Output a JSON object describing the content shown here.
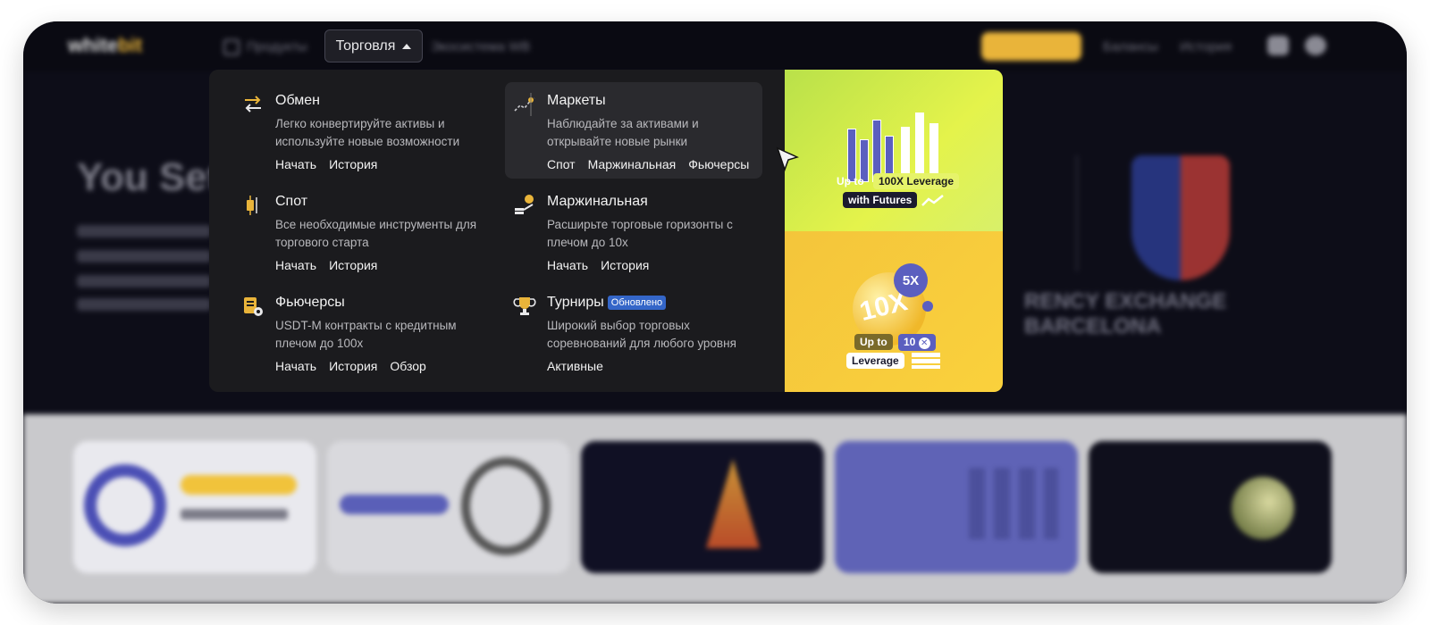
{
  "header": {
    "logo_main": "white",
    "logo_accent": "bit",
    "nav_products": "Продукты",
    "nav_trading": "Торговля",
    "nav_ecosystem": "Экосистема WB",
    "nav_right_1": "Балансы",
    "nav_right_2": "История"
  },
  "menu": {
    "items": [
      {
        "title": "Обмен",
        "desc": "Легко конвертируйте активы и используйте новые возможности",
        "links": [
          "Начать",
          "История"
        ],
        "icon": "swap-arrows-icon"
      },
      {
        "title": "Маркеты",
        "desc": "Наблюдайте за активами и открывайте новые рынки",
        "links": [
          "Спот",
          "Маржинальная",
          "Фьючерсы"
        ],
        "icon": "market-chart-icon"
      },
      {
        "title": "Спот",
        "desc": "Все необходимые инструменты для торгового старта",
        "links": [
          "Начать",
          "История"
        ],
        "icon": "candlestick-icon"
      },
      {
        "title": "Маржинальная",
        "desc": "Расширьте торговые горизонты с плечом до 10x",
        "links": [
          "Начать",
          "История"
        ],
        "icon": "margin-coins-icon"
      },
      {
        "title": "Фьючерсы",
        "desc": "USDT-M контракты с кредитным плечом до 100x",
        "links": [
          "Начать",
          "История",
          "Обзор"
        ],
        "icon": "futures-doc-icon"
      },
      {
        "title": "Турниры",
        "badge": "Обновлено",
        "desc": "Широкий выбор торговых соревнований для любого уровня",
        "links": [
          "Активные"
        ],
        "icon": "trophy-icon"
      }
    ]
  },
  "promos": {
    "futures": {
      "up_to": "Up to",
      "leverage": "100X Leverage",
      "with": "with Futures"
    },
    "margin": {
      "big": "10X",
      "small": "5X",
      "up_to": "Up to",
      "value": "10",
      "leverage": "Leverage"
    }
  },
  "colors": {
    "accent": "#e9b43a",
    "panel": "#1b1b1e",
    "badge": "#3466c8"
  }
}
